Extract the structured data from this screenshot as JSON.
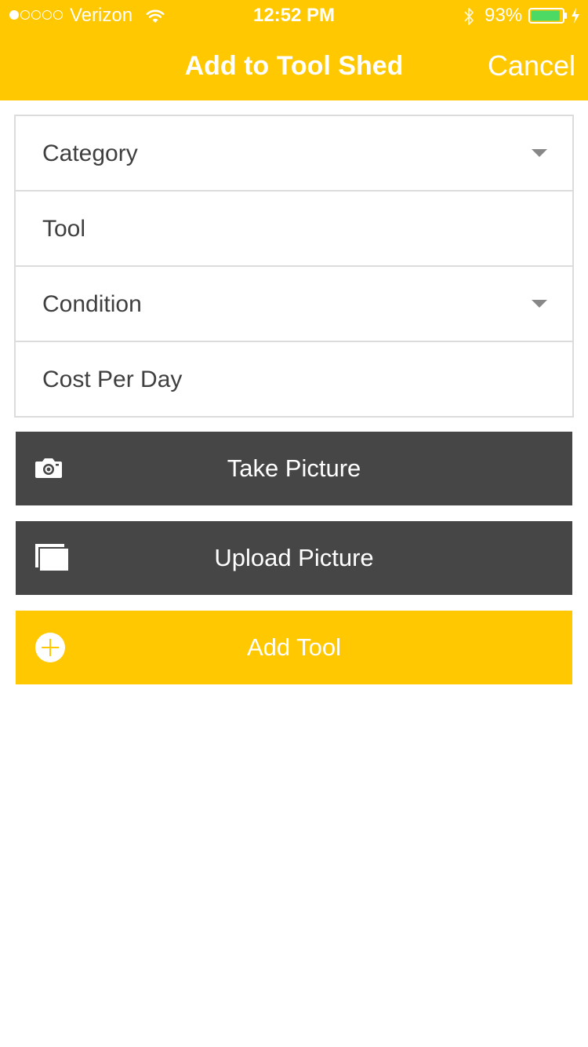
{
  "status_bar": {
    "carrier": "Verizon",
    "time": "12:52 PM",
    "battery_percent": "93%",
    "signal_strength": 1,
    "signal_max": 5,
    "battery_level": 0.93
  },
  "nav": {
    "title": "Add to Tool Shed",
    "cancel_label": "Cancel"
  },
  "form": {
    "fields": [
      {
        "label": "Category",
        "type": "dropdown"
      },
      {
        "label": "Tool",
        "type": "text"
      },
      {
        "label": "Condition",
        "type": "dropdown"
      },
      {
        "label": "Cost Per Day",
        "type": "text"
      }
    ]
  },
  "buttons": {
    "take_picture": {
      "label": "Take Picture",
      "icon": "camera-icon"
    },
    "upload_picture": {
      "label": "Upload Picture",
      "icon": "gallery-icon"
    },
    "add_tool": {
      "label": "Add Tool",
      "icon": "plus-circle-icon"
    }
  },
  "colors": {
    "accent": "#ffc800",
    "button_dark": "#464646",
    "text": "#3f3f3f",
    "border": "#dcdcdc",
    "battery_fill": "#4cd964"
  }
}
